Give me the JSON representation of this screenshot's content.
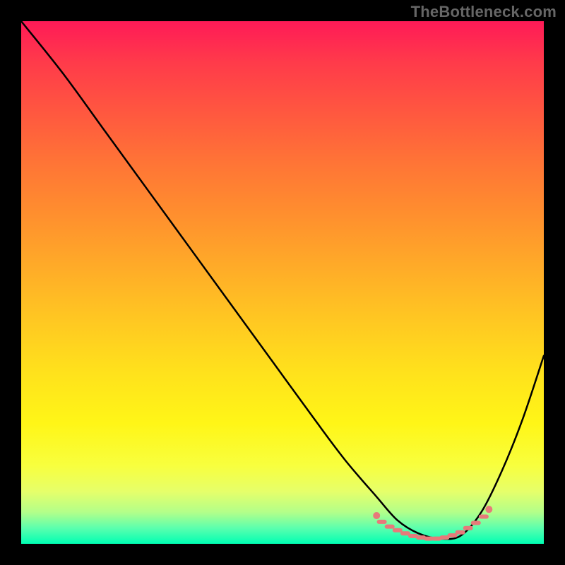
{
  "watermark": "TheBottleneck.com",
  "chart_data": {
    "type": "line",
    "title": "",
    "xlabel": "",
    "ylabel": "",
    "x": [
      0,
      8,
      16,
      24,
      32,
      40,
      48,
      56,
      62,
      68,
      72,
      76,
      80,
      84,
      88,
      92,
      96,
      100
    ],
    "values": [
      100,
      90,
      79,
      68,
      57,
      46,
      35,
      24,
      16,
      9,
      4.5,
      2,
      1,
      1.5,
      6,
      14,
      24,
      36
    ],
    "xlim": [
      0,
      100
    ],
    "ylim": [
      0,
      100
    ],
    "markers": {
      "x": [
        69,
        70.5,
        72,
        73.5,
        75,
        76.5,
        78,
        79.5,
        81,
        82.5,
        84,
        85.5,
        87,
        88.5
      ],
      "y": [
        4.2,
        3.3,
        2.6,
        2.0,
        1.5,
        1.2,
        1.0,
        1.0,
        1.2,
        1.6,
        2.2,
        3.0,
        4.0,
        5.2
      ]
    }
  }
}
